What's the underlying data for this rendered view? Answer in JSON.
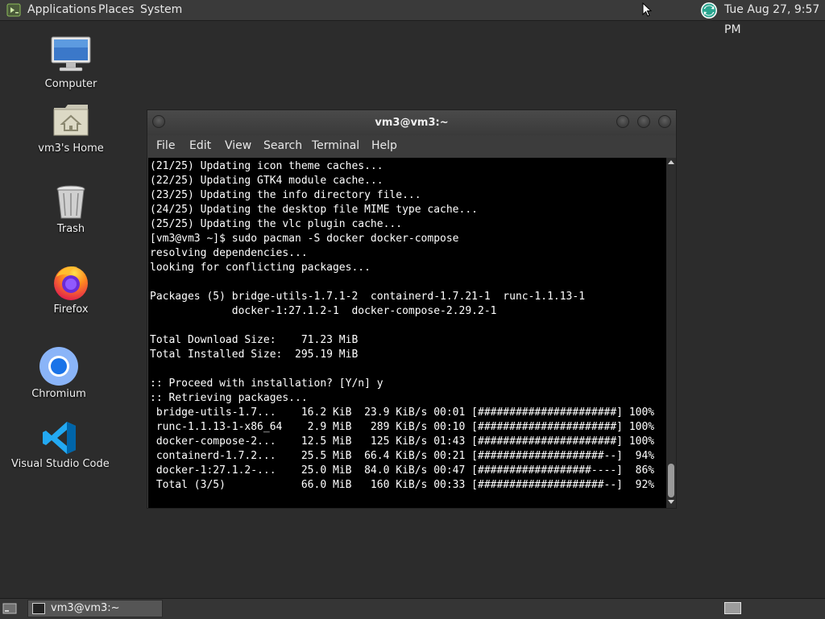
{
  "top_panel": {
    "applications": "Applications",
    "places": "Places",
    "system": "System",
    "clock": "Tue Aug 27,  9:57 PM"
  },
  "desktop_icons": {
    "computer": "Computer",
    "home": "vm3's Home",
    "trash": "Trash",
    "firefox": "Firefox",
    "chromium": "Chromium",
    "vscode": "Visual Studio Code"
  },
  "terminal": {
    "title": "vm3@vm3:~",
    "menu": {
      "file": "File",
      "edit": "Edit",
      "view": "View",
      "search": "Search",
      "terminal": "Terminal",
      "help": "Help"
    },
    "output": "(21/25) Updating icon theme caches...\n(22/25) Updating GTK4 module cache...\n(23/25) Updating the info directory file...\n(24/25) Updating the desktop file MIME type cache...\n(25/25) Updating the vlc plugin cache...\n[vm3@vm3 ~]$ sudo pacman -S docker docker-compose\nresolving dependencies...\nlooking for conflicting packages...\n\nPackages (5) bridge-utils-1.7.1-2  containerd-1.7.21-1  runc-1.1.13-1\n             docker-1:27.1.2-1  docker-compose-2.29.2-1\n\nTotal Download Size:    71.23 MiB\nTotal Installed Size:  295.19 MiB\n\n:: Proceed with installation? [Y/n] y\n:: Retrieving packages...\n bridge-utils-1.7...    16.2 KiB  23.9 KiB/s 00:01 [######################] 100%\n runc-1.1.13-1-x86_64    2.9 MiB   289 KiB/s 00:10 [######################] 100%\n docker-compose-2...    12.5 MiB   125 KiB/s 01:43 [######################] 100%\n containerd-1.7.2...    25.5 MiB  66.4 KiB/s 00:21 [####################--]  94%\n docker-1:27.1.2-...    25.0 MiB  84.0 KiB/s 00:47 [##################----]  86%\n Total (3/5)            66.0 MiB   160 KiB/s 00:33 [####################--]  92%"
  },
  "taskbar": {
    "window_label": "vm3@vm3:~"
  }
}
